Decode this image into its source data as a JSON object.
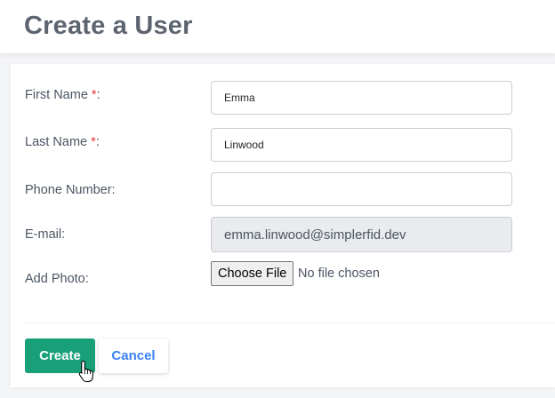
{
  "header": {
    "title": "Create a User"
  },
  "form": {
    "first_name": {
      "label": "First Name ",
      "required_mark": "*",
      "suffix": ":",
      "value": "Emma"
    },
    "last_name": {
      "label": "Last Name ",
      "required_mark": "*",
      "suffix": ":",
      "value": "Linwood"
    },
    "phone": {
      "label": "Phone Number:",
      "value": ""
    },
    "email": {
      "label": "E-mail:",
      "value": "emma.linwood@simplerfid.dev"
    },
    "photo": {
      "label": "Add Photo:",
      "button_label": "Choose File",
      "status": "No file chosen"
    }
  },
  "actions": {
    "create_label": "Create",
    "cancel_label": "Cancel"
  },
  "colors": {
    "primary": "#1aa079",
    "link": "#3b82f6",
    "required": "#e3342f"
  },
  "icons": {
    "cursor": "hand-pointer-icon"
  }
}
